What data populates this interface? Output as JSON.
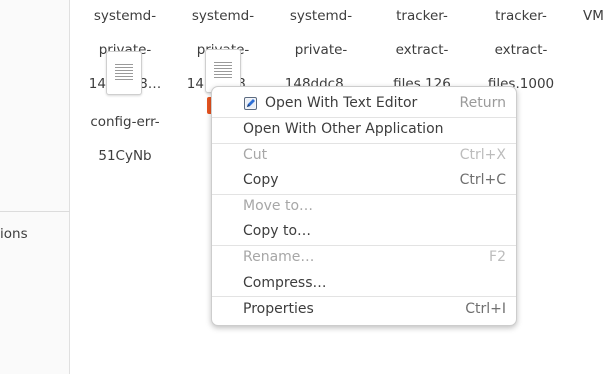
{
  "sidebar": {
    "partial_label": "ions"
  },
  "files_top_row": [
    {
      "line1": "systemd-",
      "line2": "private-",
      "line3": "148ddc8…"
    },
    {
      "line1": "systemd-",
      "line2": "private-",
      "line3": "148ddc8…"
    },
    {
      "line1": "systemd-",
      "line2": "private-",
      "line3": "148ddc8…"
    },
    {
      "line1": "tracker-",
      "line2": "extract-",
      "line3": "files.126"
    },
    {
      "line1": "tracker-",
      "line2": "extract-",
      "line3": "files.1000"
    },
    {
      "line1": "VM"
    }
  ],
  "files_second_row": [
    {
      "name_line1": "config-err-",
      "name_line2": "51CyNb"
    }
  ],
  "context_menu": {
    "items": [
      {
        "label": "Open With Text Editor",
        "accel": "Return",
        "enabled": true,
        "icon": "text-editor-icon"
      },
      {
        "label": "Open With Other Application",
        "accel": "",
        "enabled": true
      },
      {
        "label": "Cut",
        "accel": "Ctrl+X",
        "enabled": false
      },
      {
        "label": "Copy",
        "accel": "Ctrl+C",
        "enabled": true
      },
      {
        "label": "Move to…",
        "accel": "",
        "enabled": false
      },
      {
        "label": "Copy to…",
        "accel": "",
        "enabled": true
      },
      {
        "label": "Rename…",
        "accel": "F2",
        "enabled": false
      },
      {
        "label": "Compress…",
        "accel": "",
        "enabled": true
      },
      {
        "label": "Properties",
        "accel": "Ctrl+I",
        "enabled": true
      }
    ]
  },
  "colors": {
    "selection_accent": "#e95420",
    "menu_text": "#3d3d3d",
    "disabled_text": "#a7a7a7"
  }
}
